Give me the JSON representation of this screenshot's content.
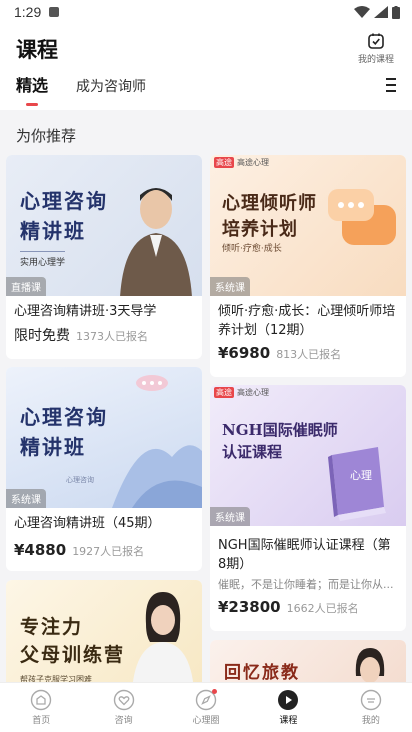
{
  "status_bar": {
    "time": "1:29"
  },
  "header": {
    "title": "课程",
    "my_course_label": "我的课程",
    "tabs": [
      {
        "label": "精选"
      },
      {
        "label": "成为咨询师"
      }
    ]
  },
  "section": {
    "title": "为你推荐"
  },
  "courses": [
    {
      "thumb_title_1": "心理咨询",
      "thumb_title_2": "精讲班",
      "thumb_sub": "实用心理学",
      "tag": "直播课",
      "title": "心理咨询精讲班·3天导学",
      "price": "限时免费",
      "enrolled": "1373人已报名"
    },
    {
      "brand_1": "高途",
      "brand_2": "高途心理",
      "thumb_title_1": "心理倾听师",
      "thumb_title_2": "培养计划",
      "thumb_sub": "倾听·疗愈·成长",
      "tag": "系统课",
      "title": "倾听·疗愈·成长：心理倾听师培养计划（12期）",
      "price": "¥6980",
      "enrolled": "813人已报名"
    },
    {
      "thumb_title_1": "心理咨询",
      "thumb_title_2": "精讲班",
      "thumb_sub": "心理咨询",
      "tag": "系统课",
      "title": "心理咨询精讲班（45期）",
      "price": "¥4880",
      "enrolled": "1927人已报名"
    },
    {
      "brand_1": "高途",
      "brand_2": "高途心理",
      "thumb_title_1": "NGH国际催眠师",
      "thumb_title_2": "认证课程",
      "book_label": "心理",
      "tag": "系统课",
      "title": "NGH国际催眠师认证课程（第8期）",
      "desc": "催眠，不是让你睡着；而是让你从...",
      "price": "¥23800",
      "enrolled": "1662人已报名"
    },
    {
      "thumb_title_1": "专注力",
      "thumb_title_2": "父母训练营",
      "thumb_sub": "帮孩子克服学习困难"
    },
    {
      "thumb_title_1": "回忆旅教"
    }
  ],
  "bottom_nav": [
    {
      "label": "首页",
      "icon": "home-icon"
    },
    {
      "label": "咨询",
      "icon": "heart-icon"
    },
    {
      "label": "心理圈",
      "icon": "compass-icon"
    },
    {
      "label": "课程",
      "icon": "play-icon"
    },
    {
      "label": "我的",
      "icon": "profile-icon"
    }
  ],
  "colors": {
    "accent": "#e8474b",
    "navy": "#24336b"
  }
}
